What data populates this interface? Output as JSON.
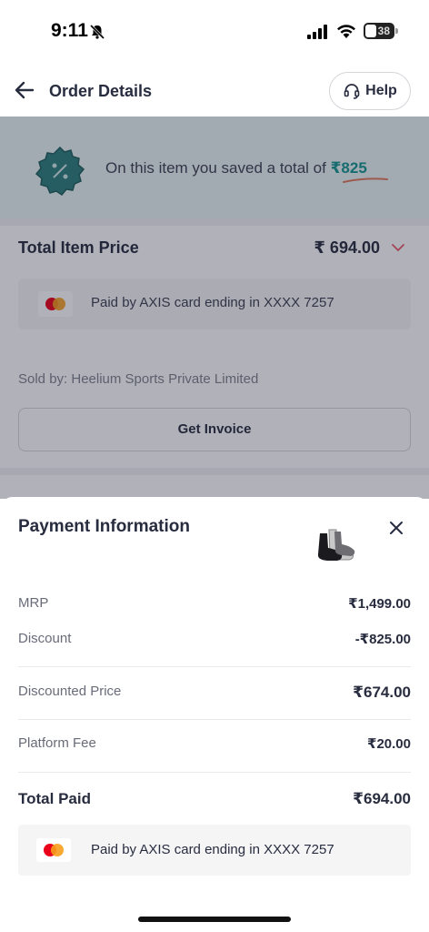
{
  "status_bar": {
    "time": "9:11",
    "battery": "38"
  },
  "header": {
    "title": "Order Details",
    "help_label": "Help"
  },
  "savings": {
    "prefix": "On this item you saved a total of ",
    "amount": "₹825"
  },
  "total_item": {
    "label": "Total Item Price",
    "value": "₹ 694.00"
  },
  "payment_card": {
    "text": "Paid by AXIS card ending in XXXX 7257"
  },
  "seller": {
    "text": "Sold by: Heelium Sports Private Limited"
  },
  "invoice": {
    "label": "Get Invoice"
  },
  "sheet": {
    "title": "Payment Information",
    "rows": [
      {
        "label": "MRP",
        "value": "₹1,499.00"
      },
      {
        "label": "Discount",
        "value": "-₹825.00"
      },
      {
        "label": "Discounted Price",
        "value": "₹674.00"
      },
      {
        "label": "Platform Fee",
        "value": "₹20.00"
      },
      {
        "label": "Total Paid",
        "value": "₹694.00"
      }
    ],
    "paid_text": "Paid by AXIS card ending in XXXX 7257"
  },
  "colors": {
    "accent": "#14958f",
    "mastercard_red": "#eb001b",
    "mastercard_yellow": "#f79e1b"
  },
  "icons": [
    "back-arrow-icon",
    "headset-icon",
    "discount-badge-icon",
    "chevron-down-icon",
    "mastercard-icon",
    "close-icon",
    "bell-off-icon",
    "signal-icon",
    "wifi-icon",
    "battery-icon"
  ]
}
